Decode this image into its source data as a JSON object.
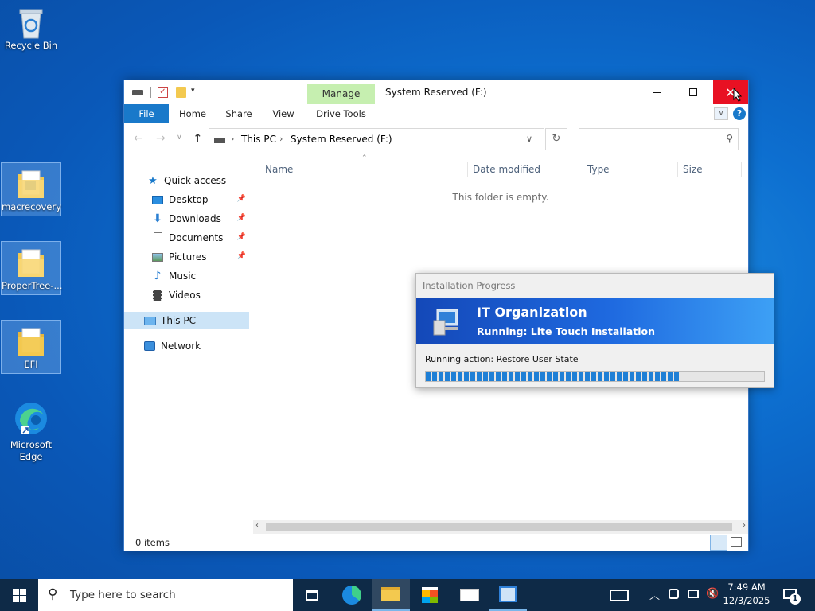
{
  "desktop": {
    "icons": [
      {
        "label": "Recycle Bin"
      },
      {
        "label": "macrecovery"
      },
      {
        "label": "ProperTree-..."
      },
      {
        "label": "EFI"
      },
      {
        "label": "Microsoft Edge"
      }
    ]
  },
  "explorer": {
    "title": "System Reserved (F:)",
    "context_tab": "Manage",
    "context_group": "Drive Tools",
    "tabs": [
      "File",
      "Home",
      "Share",
      "View"
    ],
    "breadcrumb": [
      "This PC",
      "System Reserved (F:)"
    ],
    "search_placeholder": "",
    "nav": {
      "quick_access": "Quick access",
      "items": [
        {
          "label": "Desktop",
          "pinned": true
        },
        {
          "label": "Downloads",
          "pinned": true
        },
        {
          "label": "Documents",
          "pinned": true
        },
        {
          "label": "Pictures",
          "pinned": true
        },
        {
          "label": "Music",
          "pinned": false
        },
        {
          "label": "Videos",
          "pinned": false
        }
      ],
      "this_pc": "This PC",
      "network": "Network"
    },
    "columns": [
      "Name",
      "Date modified",
      "Type",
      "Size"
    ],
    "empty_message": "This folder is empty.",
    "status": "0 items"
  },
  "install_dialog": {
    "title": "Installation Progress",
    "org": "IT Organization",
    "running": "Running: Lite Touch Installation",
    "action": "Running action: Restore User State",
    "progress": 0.75
  },
  "taskbar": {
    "search_placeholder": "Type here to search",
    "time": "7:49 AM",
    "date": "12/3/2025",
    "notification_count": "1"
  },
  "colors": {
    "accent": "#1979ca",
    "close_red": "#e81123",
    "manage_green": "#c6efb0",
    "banner_blue": "#1f5fd6",
    "progress_blue": "#1e7fd6"
  }
}
